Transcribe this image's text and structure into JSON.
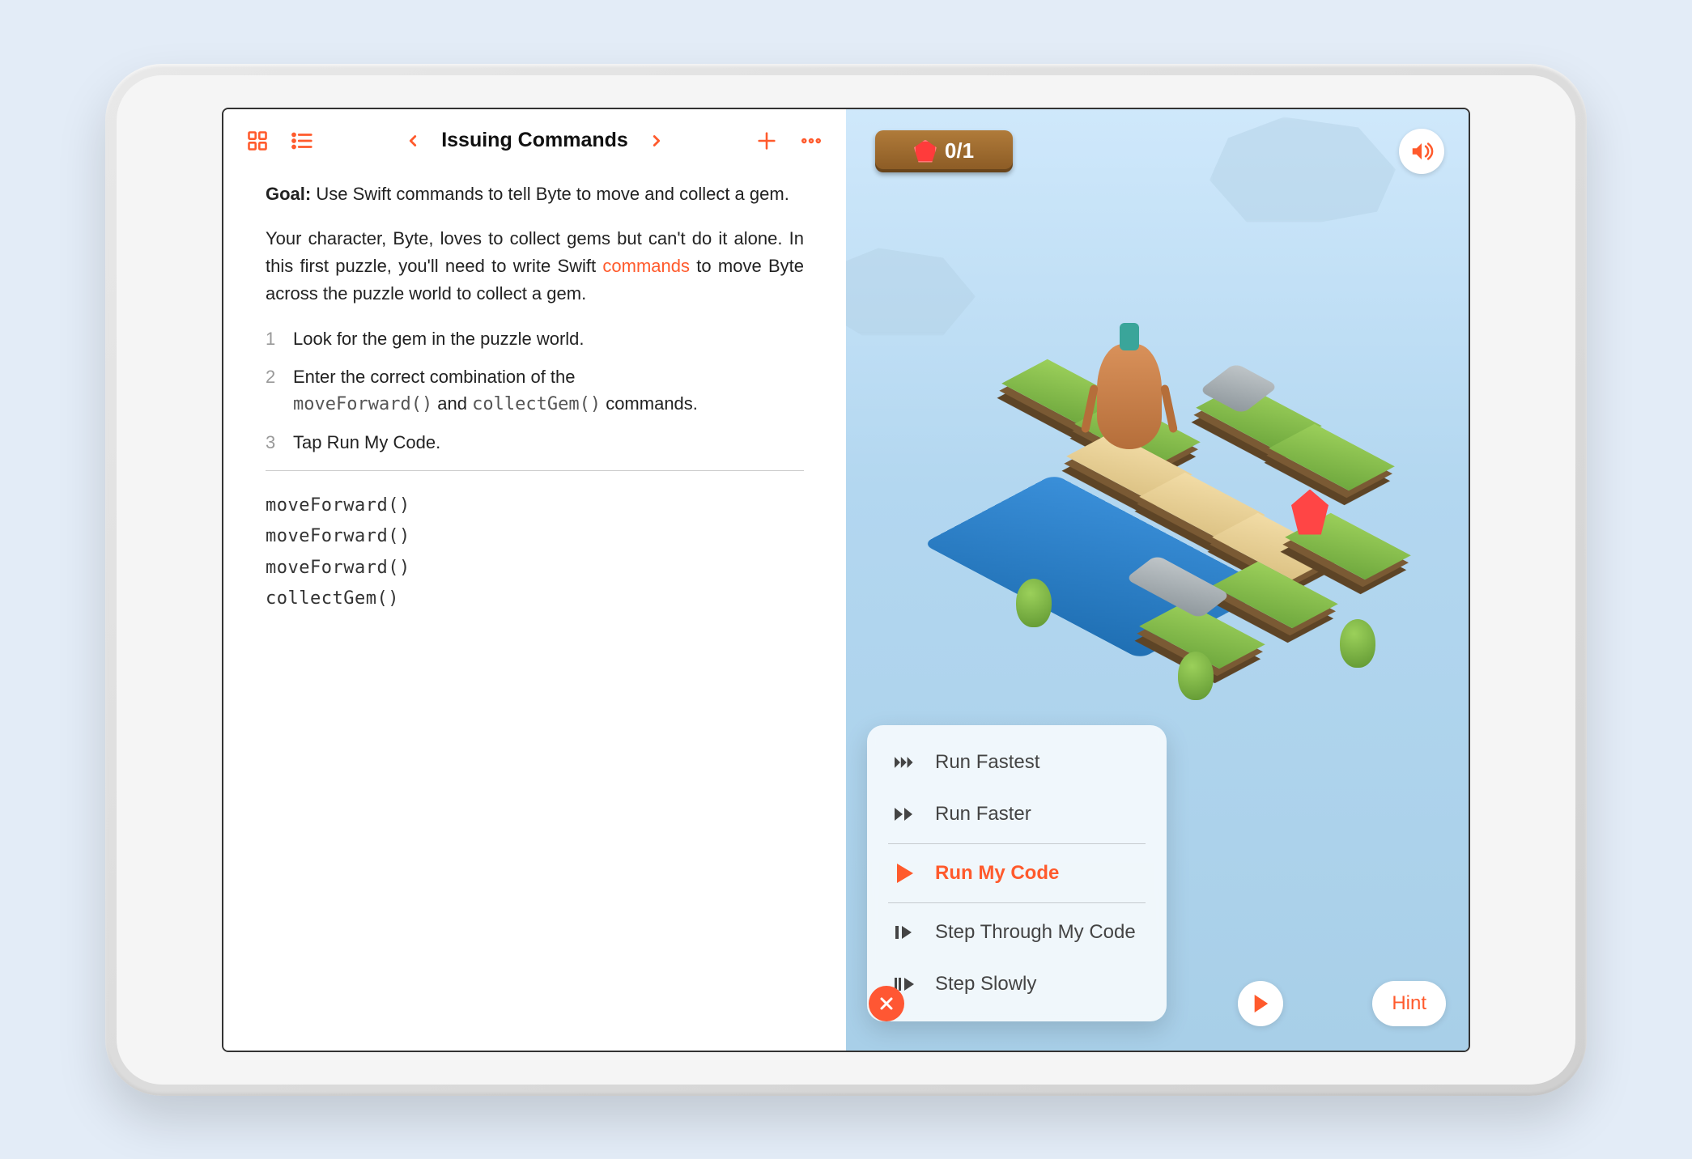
{
  "toolbar": {
    "title": "Issuing Commands"
  },
  "content": {
    "goal_label": "Goal:",
    "goal_text": " Use Swift commands to tell Byte to move and collect a gem.",
    "para_before_link": "Your character, Byte, loves to collect gems but can't do it alone. In this first puzzle, you'll need to write Swift ",
    "link_text": "commands",
    "para_after_link": " to move Byte across the puzzle world to collect a gem.",
    "steps": [
      {
        "num": "1",
        "text": "Look for the gem in the puzzle world."
      },
      {
        "num": "2",
        "text_before": "Enter the correct combination of the ",
        "code1": "moveForward()",
        "mid": " and ",
        "code2": "collectGem()",
        "text_after": " commands."
      },
      {
        "num": "3",
        "text": "Tap Run My Code."
      }
    ],
    "code_lines": [
      "moveForward()",
      "moveForward()",
      "moveForward()",
      "collectGem()"
    ]
  },
  "scene": {
    "gem_count": "0/1"
  },
  "run_menu": {
    "items": [
      {
        "label": "Run Fastest",
        "active": false
      },
      {
        "label": "Run Faster",
        "active": false
      },
      {
        "label": "Run My Code",
        "active": true
      },
      {
        "label": "Step Through My Code",
        "active": false
      },
      {
        "label": "Step Slowly",
        "active": false
      }
    ]
  },
  "hint_label": "Hint"
}
